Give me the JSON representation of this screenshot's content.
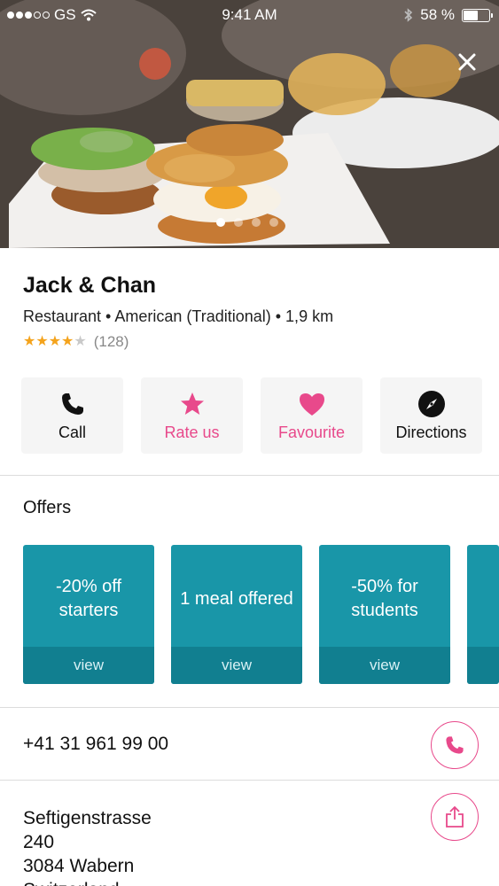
{
  "status_bar": {
    "carrier": "GS",
    "time": "9:41 AM",
    "battery": "58 %",
    "battery_level": 0.58,
    "signal_bars_filled": 3,
    "signal_bars_total": 5
  },
  "hero": {
    "page_count": 4,
    "active_page": 0
  },
  "place": {
    "name": "Jack & Chan",
    "meta": "Restaurant • American (Traditional) • 1,9 km",
    "rating_stars": 4,
    "reviews": "(128)"
  },
  "actions": [
    {
      "label": "Call",
      "icon": "phone-icon"
    },
    {
      "label": "Rate us",
      "icon": "star-icon"
    },
    {
      "label": "Favourite",
      "icon": "heart-icon"
    },
    {
      "label": "Directions",
      "icon": "compass-icon"
    }
  ],
  "offers": {
    "title": "Offers",
    "items": [
      {
        "text": "-20% off starters",
        "view": "view"
      },
      {
        "text": "1 meal offered",
        "view": "view"
      },
      {
        "text": "-50% for students",
        "view": "view"
      }
    ]
  },
  "contact": {
    "phone": "+41 31 961 99 00",
    "address_line1": "Seftigenstrasse",
    "address_line2": "240",
    "address_line3": "3084 Wabern",
    "address_line4": "Switzerland"
  },
  "colors": {
    "accent_pink": "#e8498b",
    "offer_teal": "#1996a8",
    "offer_teal_dark": "#117f90",
    "star_gold": "#f4a31c"
  }
}
